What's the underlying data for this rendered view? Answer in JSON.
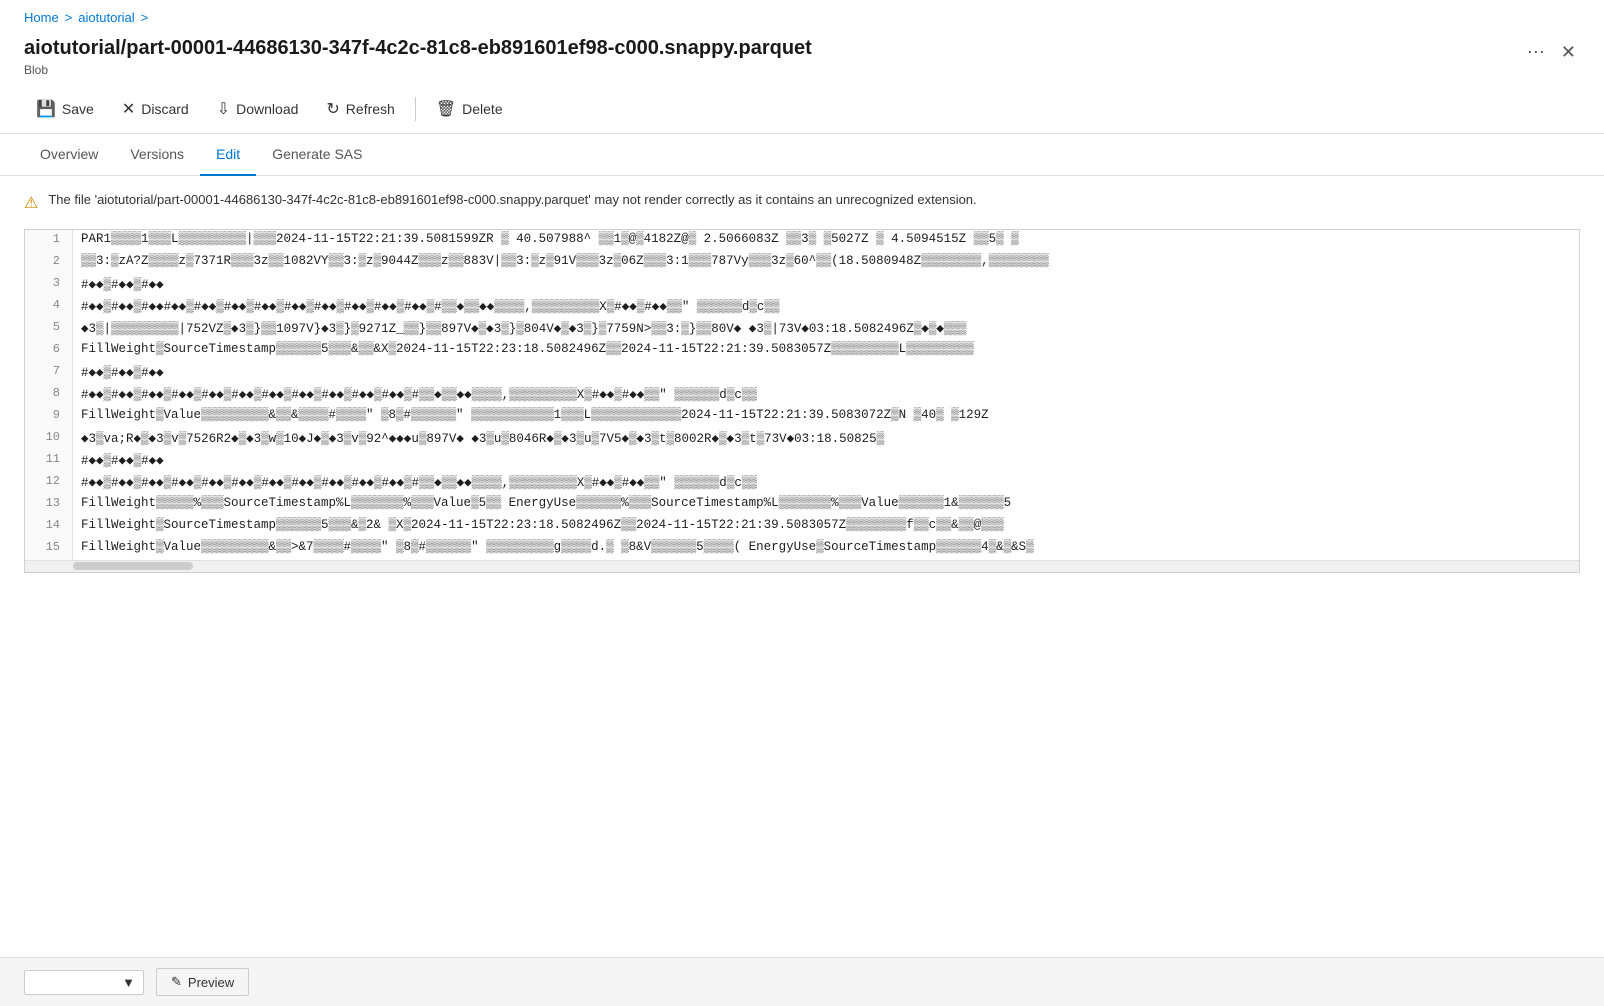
{
  "breadcrumb": {
    "home": "Home",
    "sep1": ">",
    "folder": "aiotutorial",
    "sep2": ">"
  },
  "file": {
    "title": "aiotutorial/part-00001-44686130-347f-4c2c-81c8-eb891601ef98-c000.snappy.parquet",
    "type": "Blob"
  },
  "toolbar": {
    "save_label": "Save",
    "discard_label": "Discard",
    "download_label": "Download",
    "refresh_label": "Refresh",
    "delete_label": "Delete"
  },
  "tabs": [
    "Overview",
    "Versions",
    "Edit",
    "Generate SAS"
  ],
  "active_tab": "Edit",
  "warning": {
    "text": "The file 'aiotutorial/part-00001-44686130-347f-4c2c-81c8-eb891601ef98-c000.snappy.parquet' may not render correctly as it contains an unrecognized extension."
  },
  "lines": [
    {
      "num": "1",
      "content": "PAR1▒▒▒▒1▒▒▒L▒▒▒▒▒▒▒▒▒|▒▒▒2024-11-15T22:21:39.5081599ZR ▒ 40.507988^ ▒▒1▒@▒4182Z@▒ 2.5066083Z ▒▒3▒ ▒5027Z ▒ 4.5094515Z ▒▒5▒ ▒"
    },
    {
      "num": "2",
      "content": "▒▒3:▒zA?Z▒▒▒▒z▒7371R▒▒▒3z▒▒1082VY▒▒3:▒z▒9044Z▒▒▒z▒▒883V|▒▒3:▒z▒91V▒▒▒3z▒06Z▒▒▒3:1▒▒▒787Vy▒▒▒3z▒60^▒▒(18.5080948Z▒▒▒▒▒▒▒▒,▒▒▒▒▒▒▒▒"
    },
    {
      "num": "3",
      "content": "#◆◆▒#◆◆▒#◆◆"
    },
    {
      "num": "4",
      "content": "#◆◆▒#◆◆▒#◆◆#◆◆▒#◆◆▒#◆◆▒#◆◆▒#◆◆▒#◆◆▒#◆◆▒#◆◆▒#◆◆▒#▒▒◆▒▒◆◆▒▒▒▒,▒▒▒▒▒▒▒▒▒X▒#◆◆▒#◆◆▒▒\"  ▒▒▒▒▒▒d▒c▒▒"
    },
    {
      "num": "5",
      "content": "◆3▒|▒▒▒▒▒▒▒▒▒|752VZ▒◆3▒}▒▒1097V}◆3▒}▒9271Z_▒▒}▒▒897V◆▒◆3▒}▒804V◆▒◆3▒}▒7759N>▒▒3:▒}▒▒80V◆   ◆3▒|73V◆03:18.5082496Z▒◆▒◆▒▒▒"
    },
    {
      "num": "6",
      "content": "FillWeight▒SourceTimestamp▒▒▒▒▒▒5▒▒▒&▒▒&X▒2024-11-15T22:23:18.5082496Z▒▒2024-11-15T22:21:39.5083057Z▒▒▒▒▒▒▒▒▒L▒▒▒▒▒▒▒▒▒"
    },
    {
      "num": "7",
      "content": "#◆◆▒#◆◆▒#◆◆"
    },
    {
      "num": "8",
      "content": "#◆◆▒#◆◆▒#◆◆▒#◆◆▒#◆◆▒#◆◆▒#◆◆▒#◆◆▒#◆◆▒#◆◆▒#◆◆▒#▒▒◆▒▒◆◆▒▒▒▒,▒▒▒▒▒▒▒▒▒X▒#◆◆▒#◆◆▒▒\"  ▒▒▒▒▒▒d▒c▒▒"
    },
    {
      "num": "9",
      "content": "FillWeight▒Value▒▒▒▒▒▒▒▒▒&▒▒&▒▒▒▒#▒▒▒▒\"  ▒8▒#▒▒▒▒▒▒\"  ▒▒▒▒▒▒▒▒▒▒▒1▒▒▒L▒▒▒▒▒▒▒▒▒▒▒▒2024-11-15T22:21:39.5083072Z▒N ▒40▒ ▒129Z"
    },
    {
      "num": "10",
      "content": "◆3▒va;R◆▒◆3▒v▒7526R2◆▒◆3▒w▒10◆J◆▒◆3▒v▒92^◆◆◆u▒897V◆  ◆3▒u▒8046R◆▒◆3▒u▒7V5◆▒◆3▒t▒8002R◆▒◆3▒t▒73V◆03:18.50825▒"
    },
    {
      "num": "11",
      "content": "#◆◆▒#◆◆▒#◆◆"
    },
    {
      "num": "12",
      "content": "#◆◆▒#◆◆▒#◆◆▒#◆◆▒#◆◆▒#◆◆▒#◆◆▒#◆◆▒#◆◆▒#◆◆▒#◆◆▒#▒▒◆▒▒◆◆▒▒▒▒,▒▒▒▒▒▒▒▒▒X▒#◆◆▒#◆◆▒▒\"  ▒▒▒▒▒▒d▒c▒▒"
    },
    {
      "num": "13",
      "content": "FillWeight▒▒▒▒▒%▒▒▒SourceTimestamp%L▒▒▒▒▒▒▒%▒▒▒Value▒5▒▒    EnergyUse▒▒▒▒▒▒%▒▒▒SourceTimestamp%L▒▒▒▒▒▒▒%▒▒▒Value▒▒▒▒▒▒1&▒▒▒▒▒▒5"
    },
    {
      "num": "14",
      "content": "FillWeight▒SourceTimestamp▒▒▒▒▒▒5▒▒▒&▒2&   ▒X▒2024-11-15T22:23:18.5082496Z▒▒2024-11-15T22:21:39.5083057Z▒▒▒▒▒▒▒▒f▒▒c▒▒&▒▒@▒▒▒"
    },
    {
      "num": "15",
      "content": "FillWeight▒Value▒▒▒▒▒▒▒▒▒&▒▒>&7▒▒▒▒#▒▒▒▒\"  ▒8▒#▒▒▒▒▒▒\"  ▒▒▒▒▒▒▒▒▒g▒▒▒▒d.▒ ▒8&V▒▒▒▒▒▒5▒▒▒▒(   EnergyUse▒SourceTimestamp▒▒▒▒▒▒4▒&▒&S▒"
    }
  ],
  "bottom": {
    "encoding_placeholder": "",
    "preview_label": "Preview"
  }
}
